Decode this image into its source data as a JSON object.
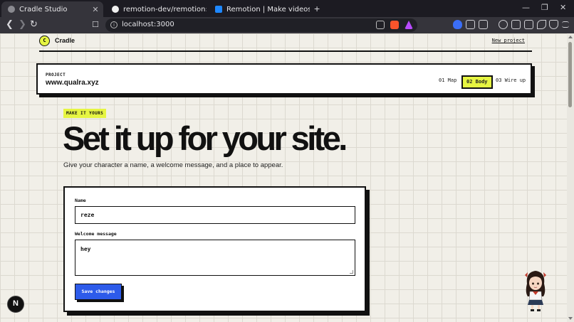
{
  "browser": {
    "tabs": [
      {
        "title": "Cradle Studio",
        "active": true
      },
      {
        "title": "remotion-dev/remotion: 🎬 Make vi",
        "active": false
      },
      {
        "title": "Remotion | Make videos programma",
        "active": false
      }
    ],
    "url": "localhost:3000",
    "new_tab_label": "+",
    "window_controls": {
      "minimize": "—",
      "restore": "❐",
      "close": "✕"
    },
    "nav": {
      "back": "❮",
      "forward": "❯",
      "reload": "↻",
      "bookmark": "☐"
    }
  },
  "app": {
    "logo_letter": "C",
    "brand": "Cradle",
    "new_project_link": "New project",
    "project": {
      "label": "PROJECT",
      "name": "www.qualra.xyz",
      "steps": [
        {
          "label": "01  Map",
          "active": false
        },
        {
          "label": "02  Body",
          "active": true
        },
        {
          "label": "03  Wire up",
          "active": false
        }
      ]
    },
    "pill": "MAKE IT YOURS",
    "headline": "Set it up for your site.",
    "subtitle": "Give your character a name, a welcome message, and a place to appear.",
    "form": {
      "name_label": "Name",
      "name_value": "reze",
      "welcome_label": "Welcome message",
      "welcome_value": "hey",
      "save_label": "Save changes"
    },
    "next_badge": "N"
  },
  "colors": {
    "accent": "#e6f542",
    "primary": "#2d5bea",
    "ink": "#111111",
    "paper": "#f1efe8"
  }
}
